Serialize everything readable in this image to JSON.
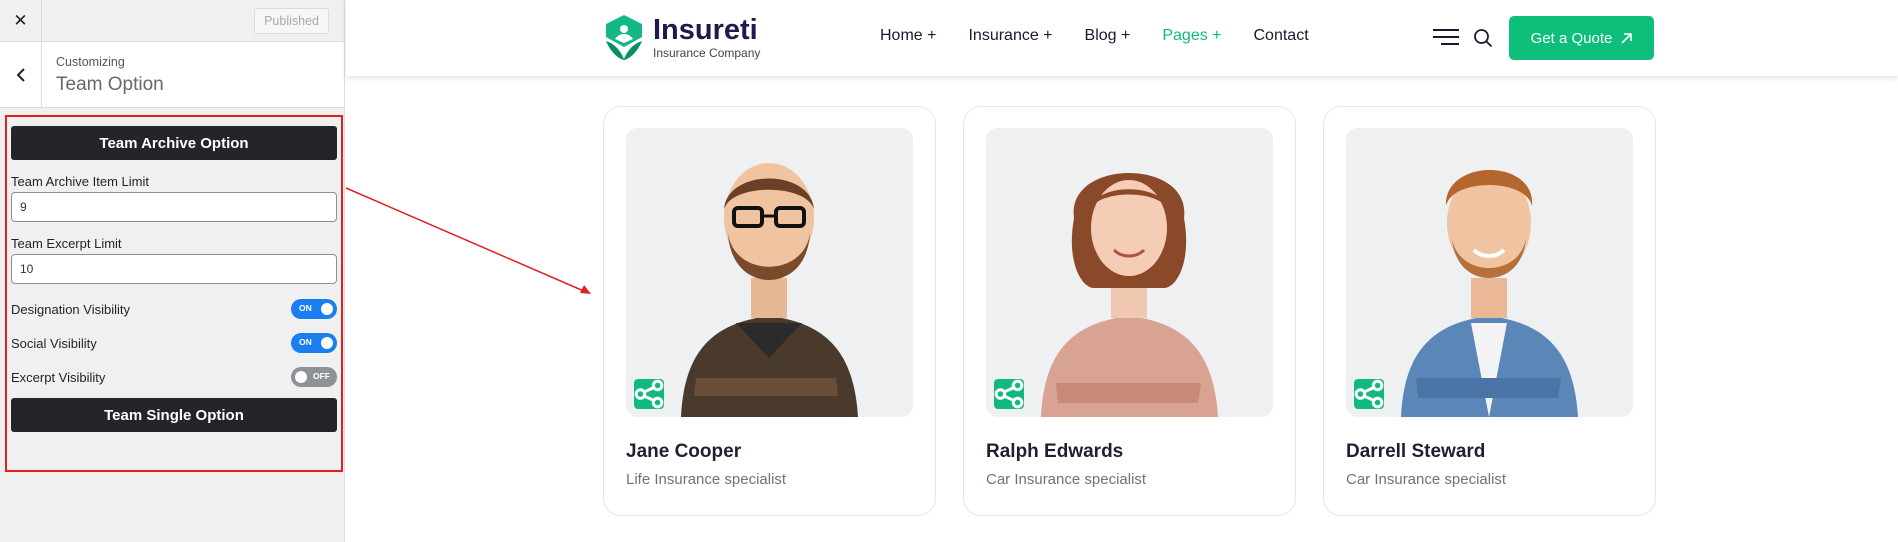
{
  "customizer": {
    "close_icon": "close-icon",
    "published_label": "Published",
    "breadcrumb": "Customizing",
    "section_title": "Team Option",
    "archive_button": "Team Archive Option",
    "archive_limit_label": "Team Archive Item Limit",
    "archive_limit_value": "9",
    "excerpt_limit_label": "Team Excerpt Limit",
    "excerpt_limit_value": "10",
    "toggles": [
      {
        "label": "Designation Visibility",
        "state": "ON"
      },
      {
        "label": "Social Visibility",
        "state": "ON"
      },
      {
        "label": "Excerpt Visibility",
        "state": "OFF"
      }
    ],
    "single_button": "Team Single Option",
    "highlight_color": "#e02020"
  },
  "site": {
    "logo_name": "Insureti",
    "logo_tagline": "Insurance Company",
    "nav": [
      {
        "label": "Home +"
      },
      {
        "label": "Insurance +"
      },
      {
        "label": "Blog +"
      },
      {
        "label": "Pages +",
        "active": true
      },
      {
        "label": "Contact"
      }
    ],
    "quote_button": "Get a Quote",
    "accent_color": "#0dbf7a",
    "team": [
      {
        "name": "Jane Cooper",
        "role": "Life Insurance specialist"
      },
      {
        "name": "Ralph Edwards",
        "role": "Car Insurance specialist"
      },
      {
        "name": "Darrell Steward",
        "role": "Car Insurance specialist"
      }
    ]
  }
}
